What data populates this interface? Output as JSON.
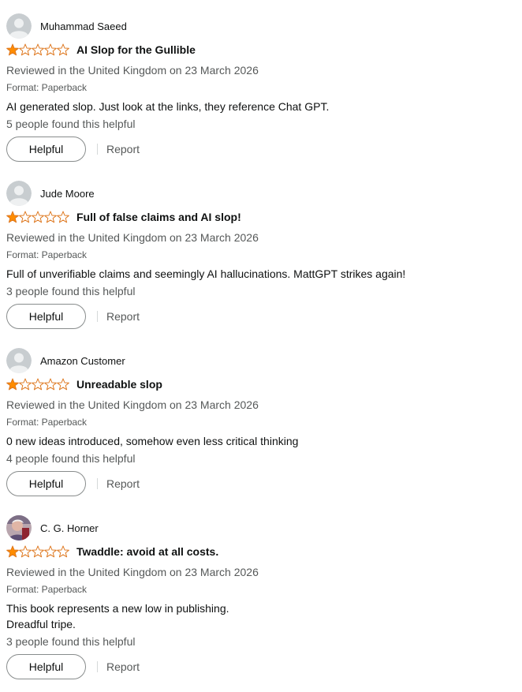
{
  "colors": {
    "star_filled": "#ff8c00",
    "star_outline": "#de7921",
    "text_primary": "#0f1111",
    "text_secondary": "#565959",
    "button_border": "#888c8c"
  },
  "reviews": [
    {
      "reviewer": "Muhammad Saeed",
      "avatar": "default-avatar-icon",
      "rating": 1,
      "rating_max": 5,
      "title": "AI Slop for the Gullible",
      "date_line": "Reviewed in the United Kingdom on 23 March 2026",
      "format": "Format: Paperback",
      "body_lines": [
        "AI generated slop. Just look at the links, they reference Chat GPT."
      ],
      "helpful_count": "5 people found this helpful",
      "helpful_label": "Helpful",
      "report_label": "Report"
    },
    {
      "reviewer": "Jude Moore",
      "avatar": "default-avatar-icon",
      "rating": 1,
      "rating_max": 5,
      "title": "Full of false claims and AI slop!",
      "date_line": "Reviewed in the United Kingdom on 23 March 2026",
      "format": "Format: Paperback",
      "body_lines": [
        "Full of unverifiable claims and seemingly AI hallucinations. MattGPT strikes again!"
      ],
      "helpful_count": "3 people found this helpful",
      "helpful_label": "Helpful",
      "report_label": "Report"
    },
    {
      "reviewer": "Amazon Customer",
      "avatar": "default-avatar-icon",
      "rating": 1,
      "rating_max": 5,
      "title": "Unreadable slop",
      "date_line": "Reviewed in the United Kingdom on 23 March 2026",
      "format": "Format: Paperback",
      "body_lines": [
        "0 new ideas introduced, somehow even less critical thinking"
      ],
      "helpful_count": "4 people found this helpful",
      "helpful_label": "Helpful",
      "report_label": "Report"
    },
    {
      "reviewer": "C. G. Horner",
      "avatar": "photo-avatar-icon",
      "rating": 1,
      "rating_max": 5,
      "title": "Twaddle: avoid at all costs.",
      "date_line": "Reviewed in the United Kingdom on 23 March 2026",
      "format": "Format: Paperback",
      "body_lines": [
        "This book represents a new low in publishing.",
        "Dreadful tripe."
      ],
      "helpful_count": "3 people found this helpful",
      "helpful_label": "Helpful",
      "report_label": "Report"
    }
  ]
}
